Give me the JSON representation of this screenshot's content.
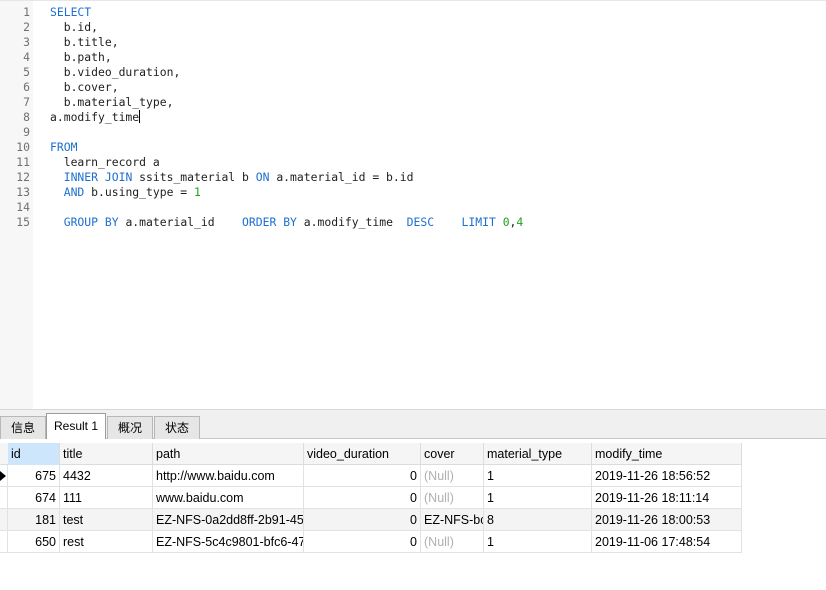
{
  "editor": {
    "lines": [
      {
        "n": "1",
        "segs": [
          {
            "t": "SELECT",
            "c": "kw"
          }
        ]
      },
      {
        "n": "2",
        "segs": [
          {
            "t": "  b.id,",
            "c": ""
          }
        ]
      },
      {
        "n": "3",
        "segs": [
          {
            "t": "  b.title,",
            "c": ""
          }
        ]
      },
      {
        "n": "4",
        "segs": [
          {
            "t": "  b.path,",
            "c": ""
          }
        ]
      },
      {
        "n": "5",
        "segs": [
          {
            "t": "  b.video_duration,",
            "c": ""
          }
        ]
      },
      {
        "n": "6",
        "segs": [
          {
            "t": "  b.cover,",
            "c": ""
          }
        ]
      },
      {
        "n": "7",
        "segs": [
          {
            "t": "  b.material_type,",
            "c": ""
          }
        ]
      },
      {
        "n": "8",
        "segs": [
          {
            "t": "a.modify_time",
            "c": ""
          }
        ],
        "caret": true
      },
      {
        "n": "9",
        "segs": []
      },
      {
        "n": "10",
        "segs": [
          {
            "t": "FROM",
            "c": "kw"
          }
        ]
      },
      {
        "n": "11",
        "segs": [
          {
            "t": "  learn_record a",
            "c": ""
          }
        ]
      },
      {
        "n": "12",
        "segs": [
          {
            "t": "  ",
            "c": ""
          },
          {
            "t": "INNER JOIN",
            "c": "kw"
          },
          {
            "t": " ssits_material b ",
            "c": ""
          },
          {
            "t": "ON",
            "c": "kw"
          },
          {
            "t": " a.material_id = b.id",
            "c": ""
          }
        ]
      },
      {
        "n": "13",
        "segs": [
          {
            "t": "  ",
            "c": ""
          },
          {
            "t": "AND",
            "c": "kw"
          },
          {
            "t": " b.using_type = ",
            "c": ""
          },
          {
            "t": "1",
            "c": "num"
          }
        ]
      },
      {
        "n": "14",
        "segs": []
      },
      {
        "n": "15",
        "segs": [
          {
            "t": "  ",
            "c": ""
          },
          {
            "t": "GROUP BY",
            "c": "kw"
          },
          {
            "t": " a.material_id    ",
            "c": ""
          },
          {
            "t": "ORDER BY",
            "c": "kw"
          },
          {
            "t": " a.modify_time  ",
            "c": ""
          },
          {
            "t": "DESC",
            "c": "kw"
          },
          {
            "t": "    ",
            "c": ""
          },
          {
            "t": "LIMIT",
            "c": "kw"
          },
          {
            "t": " ",
            "c": ""
          },
          {
            "t": "0",
            "c": "num"
          },
          {
            "t": ",",
            "c": ""
          },
          {
            "t": "4",
            "c": "num"
          }
        ]
      }
    ]
  },
  "tabs": [
    {
      "label": "信息",
      "active": false
    },
    {
      "label": "Result 1",
      "active": true
    },
    {
      "label": "概况",
      "active": false
    },
    {
      "label": "状态",
      "active": false
    }
  ],
  "grid": {
    "columns": [
      "id",
      "title",
      "path",
      "video_duration",
      "cover",
      "material_type",
      "modify_time"
    ],
    "selected_column": "id",
    "rows": [
      {
        "id": "675",
        "title": "4432",
        "path": "http://www.baidu.com",
        "video_duration": "0",
        "cover": "(Null)",
        "material_type": "1",
        "modify_time": "2019-11-26 18:56:52",
        "current": true
      },
      {
        "id": "674",
        "title": "111",
        "path": "www.baidu.com",
        "video_duration": "0",
        "cover": "(Null)",
        "material_type": "1",
        "modify_time": "2019-11-26 18:11:14",
        "current": false
      },
      {
        "id": "181",
        "title": "test",
        "path": "EZ-NFS-0a2dd8ff-2b91-45",
        "video_duration": "0",
        "cover": "EZ-NFS-bc",
        "material_type": "8",
        "modify_time": "2019-11-26 18:00:53",
        "current": false
      },
      {
        "id": "650",
        "title": "rest",
        "path": "EZ-NFS-5c4c9801-bfc6-47",
        "video_duration": "0",
        "cover": "(Null)",
        "material_type": "1",
        "modify_time": "2019-11-06 17:48:54",
        "current": false
      }
    ]
  },
  "colors": {
    "keyword": "#1c6fd0",
    "number": "#20a020",
    "null_text": "#b0b0b0",
    "header_selected": "#cde6fb"
  }
}
